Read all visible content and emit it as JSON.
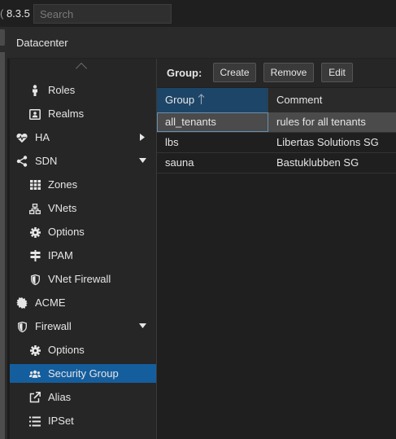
{
  "header": {
    "version_prefix": "(",
    "version": " 8.3.5",
    "search_placeholder": "Search"
  },
  "panel": {
    "title": "Datacenter"
  },
  "sidebar": {
    "items": [
      {
        "label": "Roles",
        "icon": "person-icon"
      },
      {
        "label": "Realms",
        "icon": "id-card-icon"
      },
      {
        "label": "HA",
        "icon": "heartbeat-icon",
        "expander": "collapsed"
      },
      {
        "label": "SDN",
        "icon": "sdn-icon",
        "expander": "expanded"
      },
      {
        "label": "Zones",
        "icon": "grid-icon"
      },
      {
        "label": "VNets",
        "icon": "network-icon"
      },
      {
        "label": "Options",
        "icon": "gear-icon"
      },
      {
        "label": "IPAM",
        "icon": "signpost-icon"
      },
      {
        "label": "VNet Firewall",
        "icon": "shield-icon"
      },
      {
        "label": "ACME",
        "icon": "certificate-icon"
      },
      {
        "label": "Firewall",
        "icon": "shield-icon",
        "expander": "expanded"
      },
      {
        "label": "Options",
        "icon": "gear-icon"
      },
      {
        "label": "Security Group",
        "icon": "users-icon",
        "selected": true
      },
      {
        "label": "Alias",
        "icon": "external-link-icon"
      },
      {
        "label": "IPSet",
        "icon": "list-icon"
      }
    ]
  },
  "toolbar": {
    "label": "Group:",
    "create_label": "Create",
    "remove_label": "Remove",
    "edit_label": "Edit"
  },
  "grid": {
    "columns": [
      "Group",
      "Comment"
    ],
    "sort_icon": "sort-ascending-icon",
    "rows": [
      {
        "group": "all_tenants",
        "comment": "rules for all tenants",
        "selected": true
      },
      {
        "group": "lbs",
        "comment": "Libertas Solutions SG"
      },
      {
        "group": "sauna",
        "comment": "Bastuklubben SG"
      }
    ]
  },
  "colors": {
    "selection": "#155e9e",
    "sorted_header": "#1d4568",
    "background": "#1c1c1c"
  }
}
